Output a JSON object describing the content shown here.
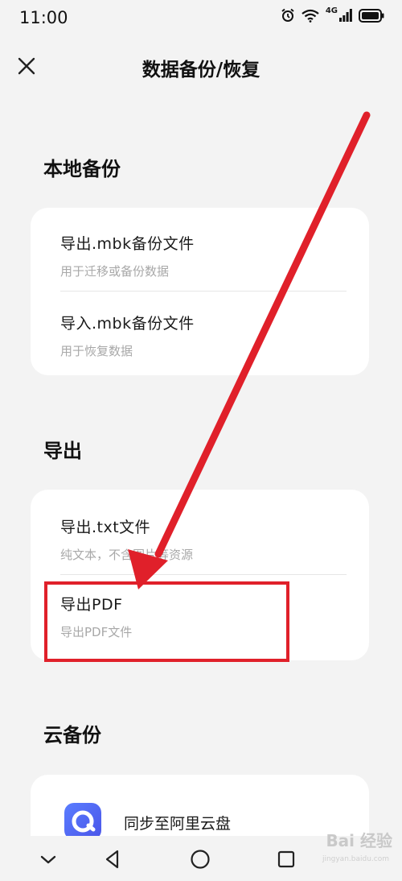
{
  "status": {
    "time": "11:00",
    "network": "4G"
  },
  "header": {
    "title": "数据备份/恢复",
    "close_icon": "close-icon"
  },
  "sections": {
    "local": {
      "title": "本地备份",
      "items": [
        {
          "title": "导出.mbk备份文件",
          "subtitle": "用于迁移或备份数据"
        },
        {
          "title": "导入.mbk备份文件",
          "subtitle": "用于恢复数据"
        }
      ]
    },
    "export": {
      "title": "导出",
      "items": [
        {
          "title": "导出.txt文件",
          "subtitle": "纯文本，不含图片等资源"
        },
        {
          "title": "导出PDF",
          "subtitle": "导出PDF文件"
        }
      ]
    },
    "cloud": {
      "title": "云备份",
      "items": [
        {
          "title": "同步至阿里云盘",
          "icon": "aliyun-drive-icon"
        }
      ]
    }
  },
  "annotation": {
    "arrow_color": "#e0202a",
    "highlight_color": "#e0202a"
  },
  "nav": {
    "back_icon": "back-triangle-icon",
    "home_icon": "home-circle-icon",
    "recent_icon": "recent-square-icon",
    "collapse_icon": "chevron-down-icon"
  },
  "watermark": {
    "text": "Bai 经验",
    "sub": "jingyan.baidu.com"
  }
}
